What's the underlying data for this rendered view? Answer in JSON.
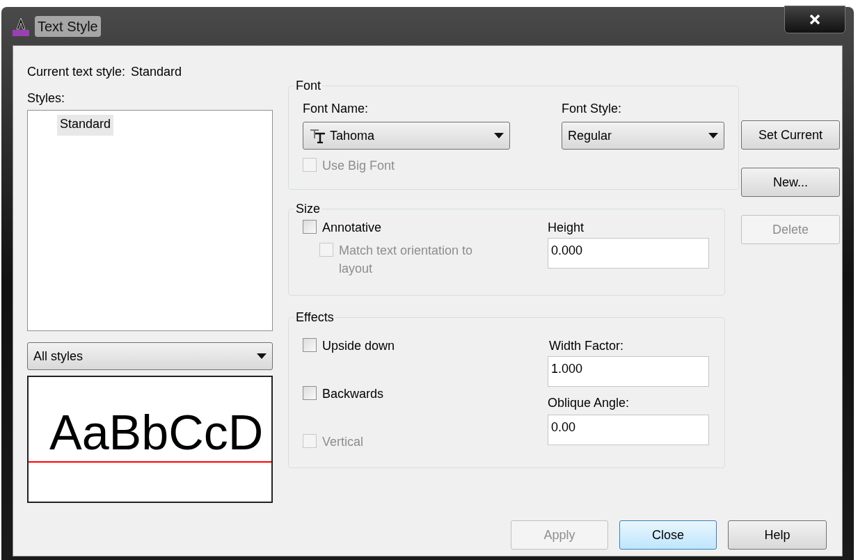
{
  "window": {
    "title": "Text Style"
  },
  "current_style": {
    "label": "Current text style:",
    "value": "Standard"
  },
  "styles": {
    "label": "Styles:",
    "items": [
      {
        "name": "Standard",
        "selected": true
      }
    ]
  },
  "filter": {
    "value": "All styles"
  },
  "preview": {
    "sample": "AaBbCcD"
  },
  "font": {
    "title": "Font",
    "font_name": {
      "label": "Font Name:",
      "value": "Tahoma"
    },
    "font_style": {
      "label": "Font Style:",
      "value": "Regular"
    },
    "use_big_font": {
      "label": "Use Big Font",
      "checked": false,
      "disabled": true
    }
  },
  "size": {
    "title": "Size",
    "annotative": {
      "label": "Annotative",
      "checked": false,
      "disabled": false
    },
    "match_orientation": {
      "label": "Match text orientation to layout",
      "checked": false,
      "disabled": true
    },
    "height": {
      "label": "Height",
      "value": "0.000"
    }
  },
  "effects": {
    "title": "Effects",
    "options": [
      {
        "label": "Upside down",
        "checked": false,
        "disabled": false
      },
      {
        "label": "Backwards",
        "checked": false,
        "disabled": false
      },
      {
        "label": "Vertical",
        "checked": false,
        "disabled": true
      }
    ],
    "width_factor": {
      "label": "Width Factor:",
      "value": "1.000"
    },
    "oblique_angle": {
      "label": "Oblique Angle:",
      "value": "0.00"
    }
  },
  "side_buttons": [
    {
      "label": "Set Current",
      "disabled": false
    },
    {
      "label": "New...",
      "disabled": false
    },
    {
      "label": "Delete",
      "disabled": true
    }
  ],
  "bottom_buttons": [
    {
      "label": "Apply",
      "disabled": true,
      "default": false
    },
    {
      "label": "Close",
      "disabled": false,
      "default": true
    },
    {
      "label": "Help",
      "disabled": false,
      "default": false
    }
  ]
}
